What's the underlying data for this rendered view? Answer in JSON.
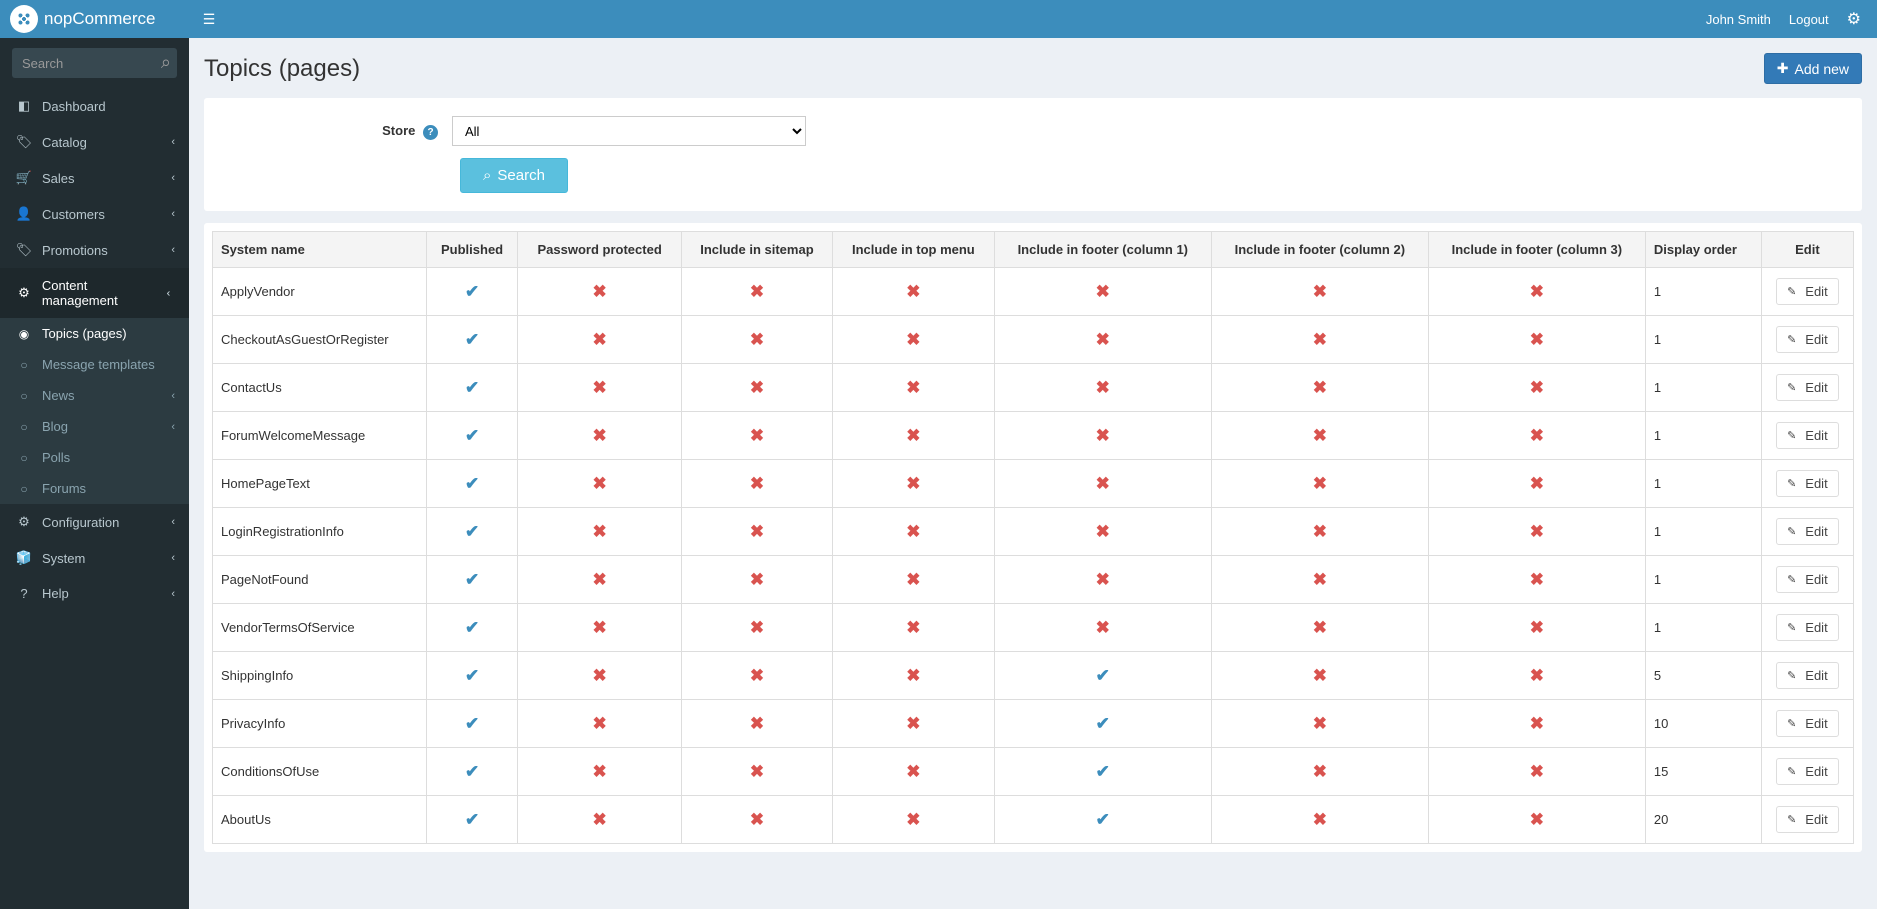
{
  "brand": "nopCommerce",
  "header": {
    "username": "John Smith",
    "logout": "Logout"
  },
  "sidebar": {
    "search_placeholder": "Search",
    "items": [
      {
        "icon": "◧",
        "label": "Dashboard",
        "expandable": false
      },
      {
        "icon": "🏷",
        "label": "Catalog",
        "expandable": true
      },
      {
        "icon": "🛒",
        "label": "Sales",
        "expandable": true
      },
      {
        "icon": "👤",
        "label": "Customers",
        "expandable": true
      },
      {
        "icon": "🏷",
        "label": "Promotions",
        "expandable": true
      },
      {
        "icon": "⚙",
        "label": "Content management",
        "expandable": true,
        "open": true,
        "children": [
          {
            "label": "Topics (pages)",
            "active": true
          },
          {
            "label": "Message templates"
          },
          {
            "label": "News",
            "expandable": true
          },
          {
            "label": "Blog",
            "expandable": true
          },
          {
            "label": "Polls"
          },
          {
            "label": "Forums"
          }
        ]
      },
      {
        "icon": "⚙",
        "label": "Configuration",
        "expandable": true
      },
      {
        "icon": "🧊",
        "label": "System",
        "expandable": true
      },
      {
        "icon": "?",
        "label": "Help",
        "expandable": true
      }
    ]
  },
  "page": {
    "title": "Topics (pages)",
    "add_button": "Add new"
  },
  "filter": {
    "store_label": "Store",
    "store_value": "All",
    "search_button": "Search"
  },
  "table": {
    "columns": [
      "System name",
      "Published",
      "Password protected",
      "Include in sitemap",
      "Include in top menu",
      "Include in footer (column 1)",
      "Include in footer (column 2)",
      "Include in footer (column 3)",
      "Display order",
      "Edit"
    ],
    "edit_label": "Edit",
    "rows": [
      {
        "name": "ApplyVendor",
        "published": true,
        "password": false,
        "sitemap": false,
        "topmenu": false,
        "f1": false,
        "f2": false,
        "f3": false,
        "order": "1"
      },
      {
        "name": "CheckoutAsGuestOrRegister",
        "published": true,
        "password": false,
        "sitemap": false,
        "topmenu": false,
        "f1": false,
        "f2": false,
        "f3": false,
        "order": "1"
      },
      {
        "name": "ContactUs",
        "published": true,
        "password": false,
        "sitemap": false,
        "topmenu": false,
        "f1": false,
        "f2": false,
        "f3": false,
        "order": "1"
      },
      {
        "name": "ForumWelcomeMessage",
        "published": true,
        "password": false,
        "sitemap": false,
        "topmenu": false,
        "f1": false,
        "f2": false,
        "f3": false,
        "order": "1"
      },
      {
        "name": "HomePageText",
        "published": true,
        "password": false,
        "sitemap": false,
        "topmenu": false,
        "f1": false,
        "f2": false,
        "f3": false,
        "order": "1"
      },
      {
        "name": "LoginRegistrationInfo",
        "published": true,
        "password": false,
        "sitemap": false,
        "topmenu": false,
        "f1": false,
        "f2": false,
        "f3": false,
        "order": "1"
      },
      {
        "name": "PageNotFound",
        "published": true,
        "password": false,
        "sitemap": false,
        "topmenu": false,
        "f1": false,
        "f2": false,
        "f3": false,
        "order": "1"
      },
      {
        "name": "VendorTermsOfService",
        "published": true,
        "password": false,
        "sitemap": false,
        "topmenu": false,
        "f1": false,
        "f2": false,
        "f3": false,
        "order": "1"
      },
      {
        "name": "ShippingInfo",
        "published": true,
        "password": false,
        "sitemap": false,
        "topmenu": false,
        "f1": true,
        "f2": false,
        "f3": false,
        "order": "5"
      },
      {
        "name": "PrivacyInfo",
        "published": true,
        "password": false,
        "sitemap": false,
        "topmenu": false,
        "f1": true,
        "f2": false,
        "f3": false,
        "order": "10"
      },
      {
        "name": "ConditionsOfUse",
        "published": true,
        "password": false,
        "sitemap": false,
        "topmenu": false,
        "f1": true,
        "f2": false,
        "f3": false,
        "order": "15"
      },
      {
        "name": "AboutUs",
        "published": true,
        "password": false,
        "sitemap": false,
        "topmenu": false,
        "f1": true,
        "f2": false,
        "f3": false,
        "order": "20"
      }
    ]
  }
}
